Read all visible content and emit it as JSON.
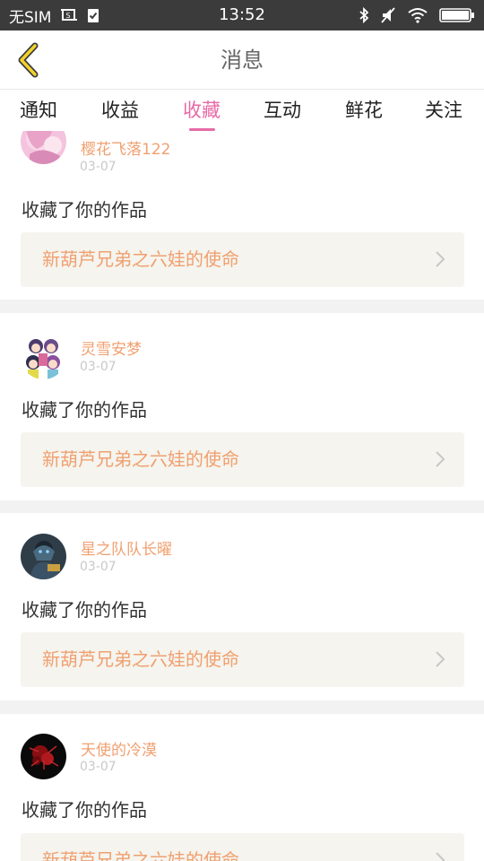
{
  "status_bar": {
    "carrier": "无SIM",
    "time": "13:52"
  },
  "header": {
    "title": "消息"
  },
  "tabs": [
    {
      "label": "通知"
    },
    {
      "label": "收益"
    },
    {
      "label": "收藏",
      "active": true
    },
    {
      "label": "互动"
    },
    {
      "label": "鲜花"
    },
    {
      "label": "关注"
    }
  ],
  "colors": {
    "accent": "#e76aa6",
    "username": "#f0a070",
    "status_bar": "#3b3b3b",
    "work_bg": "#f5f4ee"
  },
  "items": [
    {
      "username": "樱花飞落122",
      "date": "03-07",
      "action": "收藏了你的作品",
      "work_title": "新葫芦兄弟之六娃的使命",
      "avatar_icon": "pink-anime-avatar"
    },
    {
      "username": "灵雪安梦",
      "date": "03-07",
      "action": "收藏了你的作品",
      "work_title": "新葫芦兄弟之六娃的使命",
      "avatar_icon": "anime-group-avatar"
    },
    {
      "username": "星之队队长曜",
      "date": "03-07",
      "action": "收藏了你的作品",
      "work_title": "新葫芦兄弟之六娃的使命",
      "avatar_icon": "game-hero-avatar"
    },
    {
      "username": "天使的冷漠",
      "date": "03-07",
      "action": "收藏了你的作品",
      "work_title": "新葫芦兄弟之六娃的使命",
      "avatar_icon": "red-flower-avatar"
    }
  ]
}
